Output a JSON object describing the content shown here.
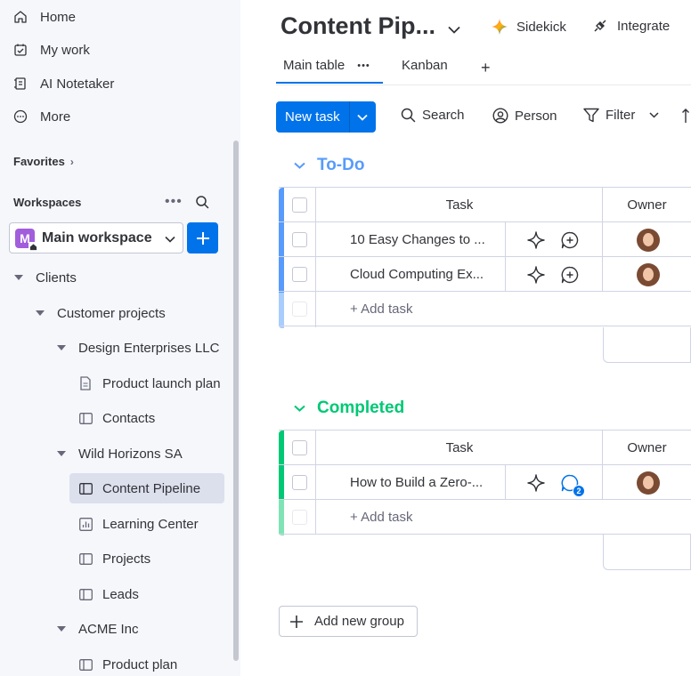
{
  "sidebar": {
    "nav": [
      {
        "label": "Home",
        "icon": "home-icon"
      },
      {
        "label": "My work",
        "icon": "my-work-icon"
      },
      {
        "label": "AI Notetaker",
        "icon": "notetaker-icon"
      },
      {
        "label": "More",
        "icon": "more-icon"
      }
    ],
    "favorites_label": "Favorites",
    "workspaces_label": "Workspaces",
    "workspace": {
      "badge": "M",
      "name": "Main workspace",
      "color": "#a25ddc"
    },
    "tree": [
      {
        "label": "Clients",
        "kind": "folder"
      },
      {
        "label": "Customer projects",
        "kind": "folder"
      },
      {
        "label": "Design Enterprises LLC",
        "kind": "folder"
      },
      {
        "label": "Product launch plan",
        "kind": "doc"
      },
      {
        "label": "Contacts",
        "kind": "board"
      },
      {
        "label": "Wild Horizons SA",
        "kind": "folder"
      },
      {
        "label": "Content Pipeline",
        "kind": "board",
        "active": true
      },
      {
        "label": "Learning Center",
        "kind": "dashboard"
      },
      {
        "label": "Projects",
        "kind": "board"
      },
      {
        "label": "Leads",
        "kind": "board"
      },
      {
        "label": "ACME Inc",
        "kind": "folder"
      },
      {
        "label": "Product plan",
        "kind": "board"
      }
    ]
  },
  "header": {
    "title": "Content Pip...",
    "sidekick_label": "Sidekick",
    "integrate_label": "Integrate",
    "tabs": [
      {
        "label": "Main table",
        "active": true
      },
      {
        "label": "Kanban"
      }
    ],
    "tab_menu": "•••",
    "add_view": "+"
  },
  "toolbar": {
    "new_task": "New task",
    "search": "Search",
    "person": "Person",
    "filter": "Filter"
  },
  "groups": [
    {
      "title": "To-Do",
      "color": "#579bfc",
      "columns": {
        "task": "Task",
        "owner": "Owner"
      },
      "rows": [
        {
          "task": "10 Easy Changes to ...",
          "updates": 0
        },
        {
          "task": "Cloud Computing Ex...",
          "updates": 0
        }
      ],
      "add_label": "+ Add task"
    },
    {
      "title": "Completed",
      "color": "#00c875",
      "columns": {
        "task": "Task",
        "owner": "Owner"
      },
      "rows": [
        {
          "task": "How to Build a Zero-...",
          "updates": 2
        }
      ],
      "add_label": "+ Add task"
    }
  ],
  "add_group_label": "Add new group",
  "colors": {
    "primary": "#0073ea",
    "todo": "#579bfc",
    "done": "#00c875"
  }
}
